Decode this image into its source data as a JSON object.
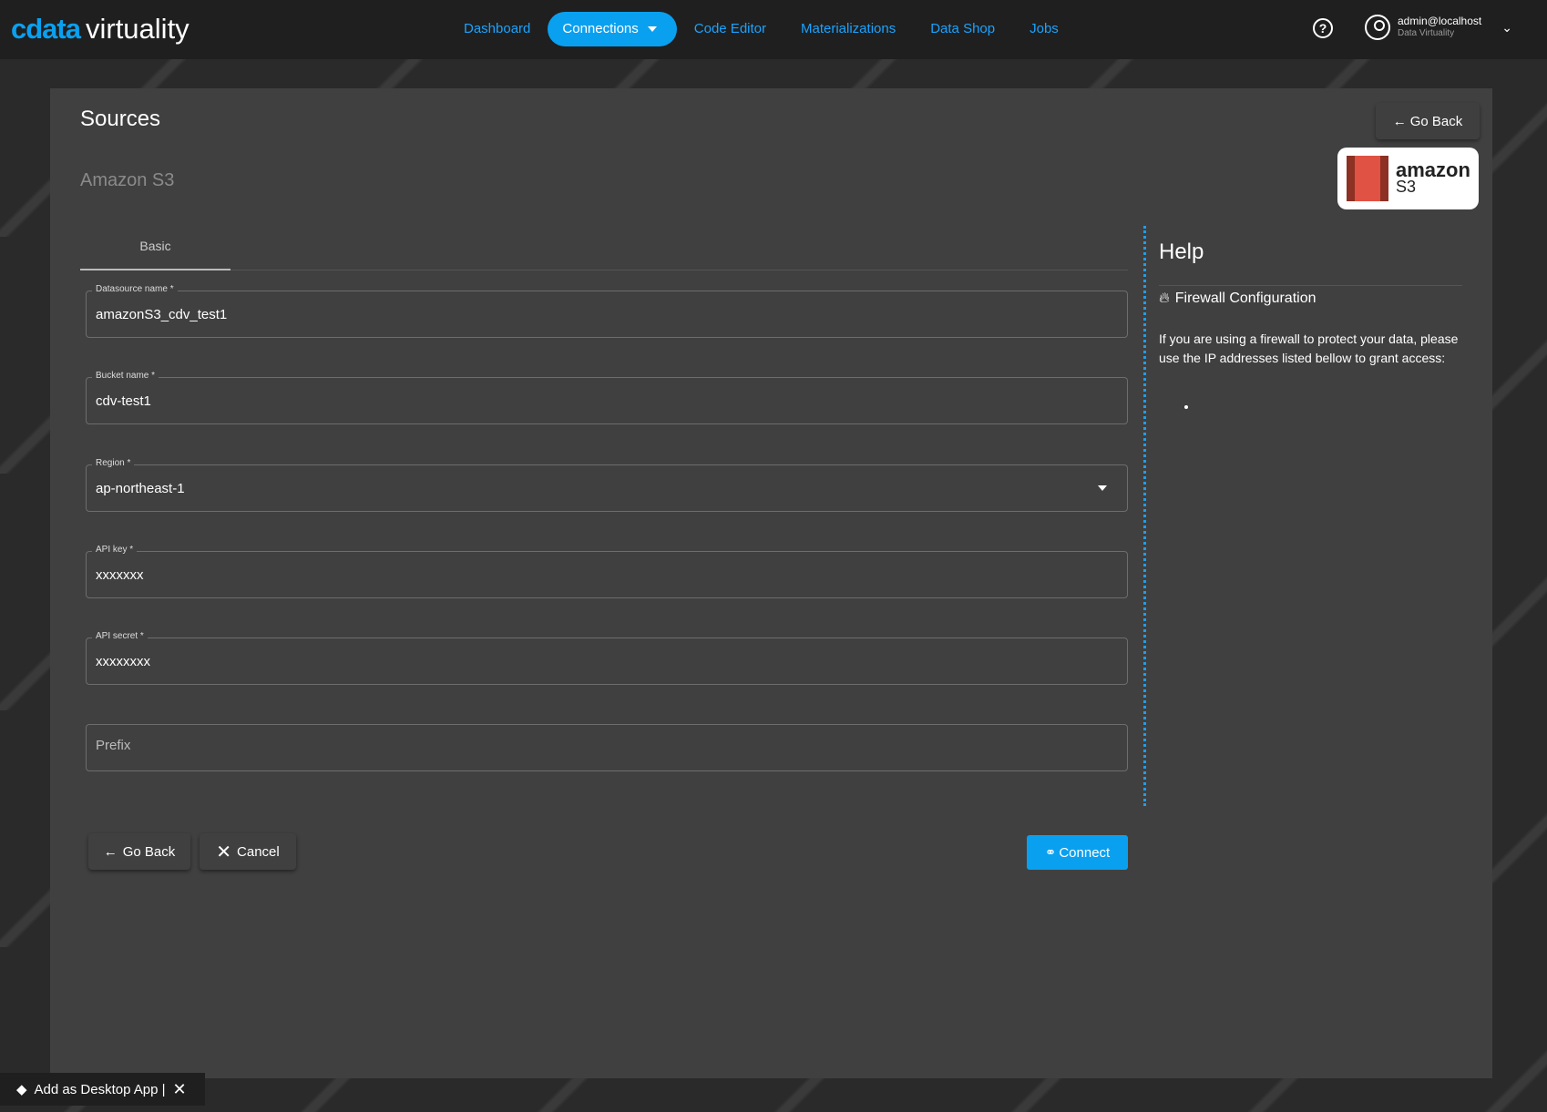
{
  "brand": {
    "logo_primary": "cdata",
    "logo_secondary": "virtuality"
  },
  "nav": {
    "items": [
      "Dashboard",
      "Connections",
      "Code Editor",
      "Materializations",
      "Data Shop",
      "Jobs"
    ],
    "active": "Connections"
  },
  "user": {
    "name": "admin@localhost",
    "org": "Data Virtuality"
  },
  "page": {
    "title": "Sources",
    "subtitle": "Amazon S3",
    "go_back": "Go Back",
    "logo_word": "amazon",
    "logo_sub": "S3"
  },
  "tabs": [
    "Basic"
  ],
  "fields": [
    {
      "label": "Datasource name *",
      "value": "amazonS3_cdv_test1"
    },
    {
      "label": "Bucket name *",
      "value": "cdv-test1"
    },
    {
      "label": "Region *",
      "value": "ap-northeast-1"
    },
    {
      "label": "API key *",
      "value": "xxxxxxx"
    },
    {
      "label": "API secret *",
      "value": "xxxxxxxx"
    },
    {
      "placeholder": "Prefix",
      "value": ""
    }
  ],
  "help": {
    "title": "Help",
    "section": "Firewall Configuration",
    "text": "If you are using a firewall to protect your data, please use the IP addresses listed bellow to grant access:"
  },
  "actions": {
    "go_back": "Go Back",
    "cancel": "Cancel",
    "connect": "Connect"
  },
  "toast": {
    "label": "Add as Desktop App |"
  },
  "colors": {
    "accent": "#0aa0f0",
    "panel": "#404040",
    "header": "#1f1f1f"
  }
}
